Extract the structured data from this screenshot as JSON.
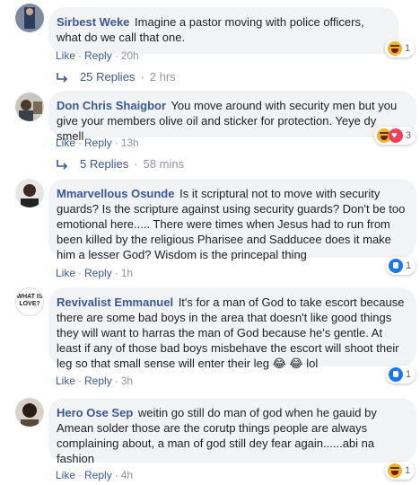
{
  "comments": [
    {
      "author": "Sirbest Weke",
      "text": "Imagine a pastor moving with police officers, what do we call that one.",
      "actions": {
        "like": "Like",
        "reply": "Reply",
        "time": "20h"
      },
      "reactions": {
        "types": [
          "haha-icon"
        ],
        "count": "1"
      },
      "replies": {
        "label": "25 Replies",
        "time": "2 hrs"
      }
    },
    {
      "author": "Don Chris Shaigbor",
      "text": "You move around with security men but you give your members olive oil and sticker for protection. Yeye dy smell",
      "actions": {
        "like": "Like",
        "reply": "Reply",
        "time": "13h"
      },
      "reactions": {
        "types": [
          "haha-icon",
          "love-icon"
        ],
        "count": "3"
      },
      "replies": {
        "label": "5 Replies",
        "time": "58 mins"
      }
    },
    {
      "author": "Mmarvellous Osunde",
      "text": "Is it scriptural not to move with security guards? Is the scripture against using security guards? Don't be too emotional here..... There were times when Jesus had to run from been killed by the religious Pharisee and Sadducee does it make him a lesser God? Wisdom is the princepal thing",
      "actions": {
        "like": "Like",
        "reply": "Reply",
        "time": "1h"
      },
      "reactions": {
        "types": [
          "like-icon"
        ],
        "count": "1"
      }
    },
    {
      "author": "Revivalist Emmanuel",
      "text": "It's for a man of God to take escort because there are some bad boys in the area that doesn't like good things they will want to harras the man of God because he's gentle. At least if any of those bad boys misbehave the escort will shoot their leg so that small sense will enter their leg 😂 😂 lol",
      "actions": {
        "like": "Like",
        "reply": "Reply",
        "time": "3h"
      },
      "reactions": {
        "types": [
          "like-icon"
        ],
        "count": "1"
      },
      "avatar_text": "WHAT IS LOVE?"
    },
    {
      "author": "Hero Ose Sep",
      "text": "weitin go still do man of god when he gauid by Amean solder those are the corutp things people are always complaining about, a man of god still dey fear again......abi na fashion",
      "actions": {
        "like": "Like",
        "reply": "Reply",
        "time": "4h"
      },
      "reactions": {
        "types": [
          "haha-icon"
        ],
        "count": "1"
      }
    }
  ],
  "colors": {
    "name": "#385898",
    "bubble": "#f2f3f5",
    "meta": "#90949c"
  }
}
